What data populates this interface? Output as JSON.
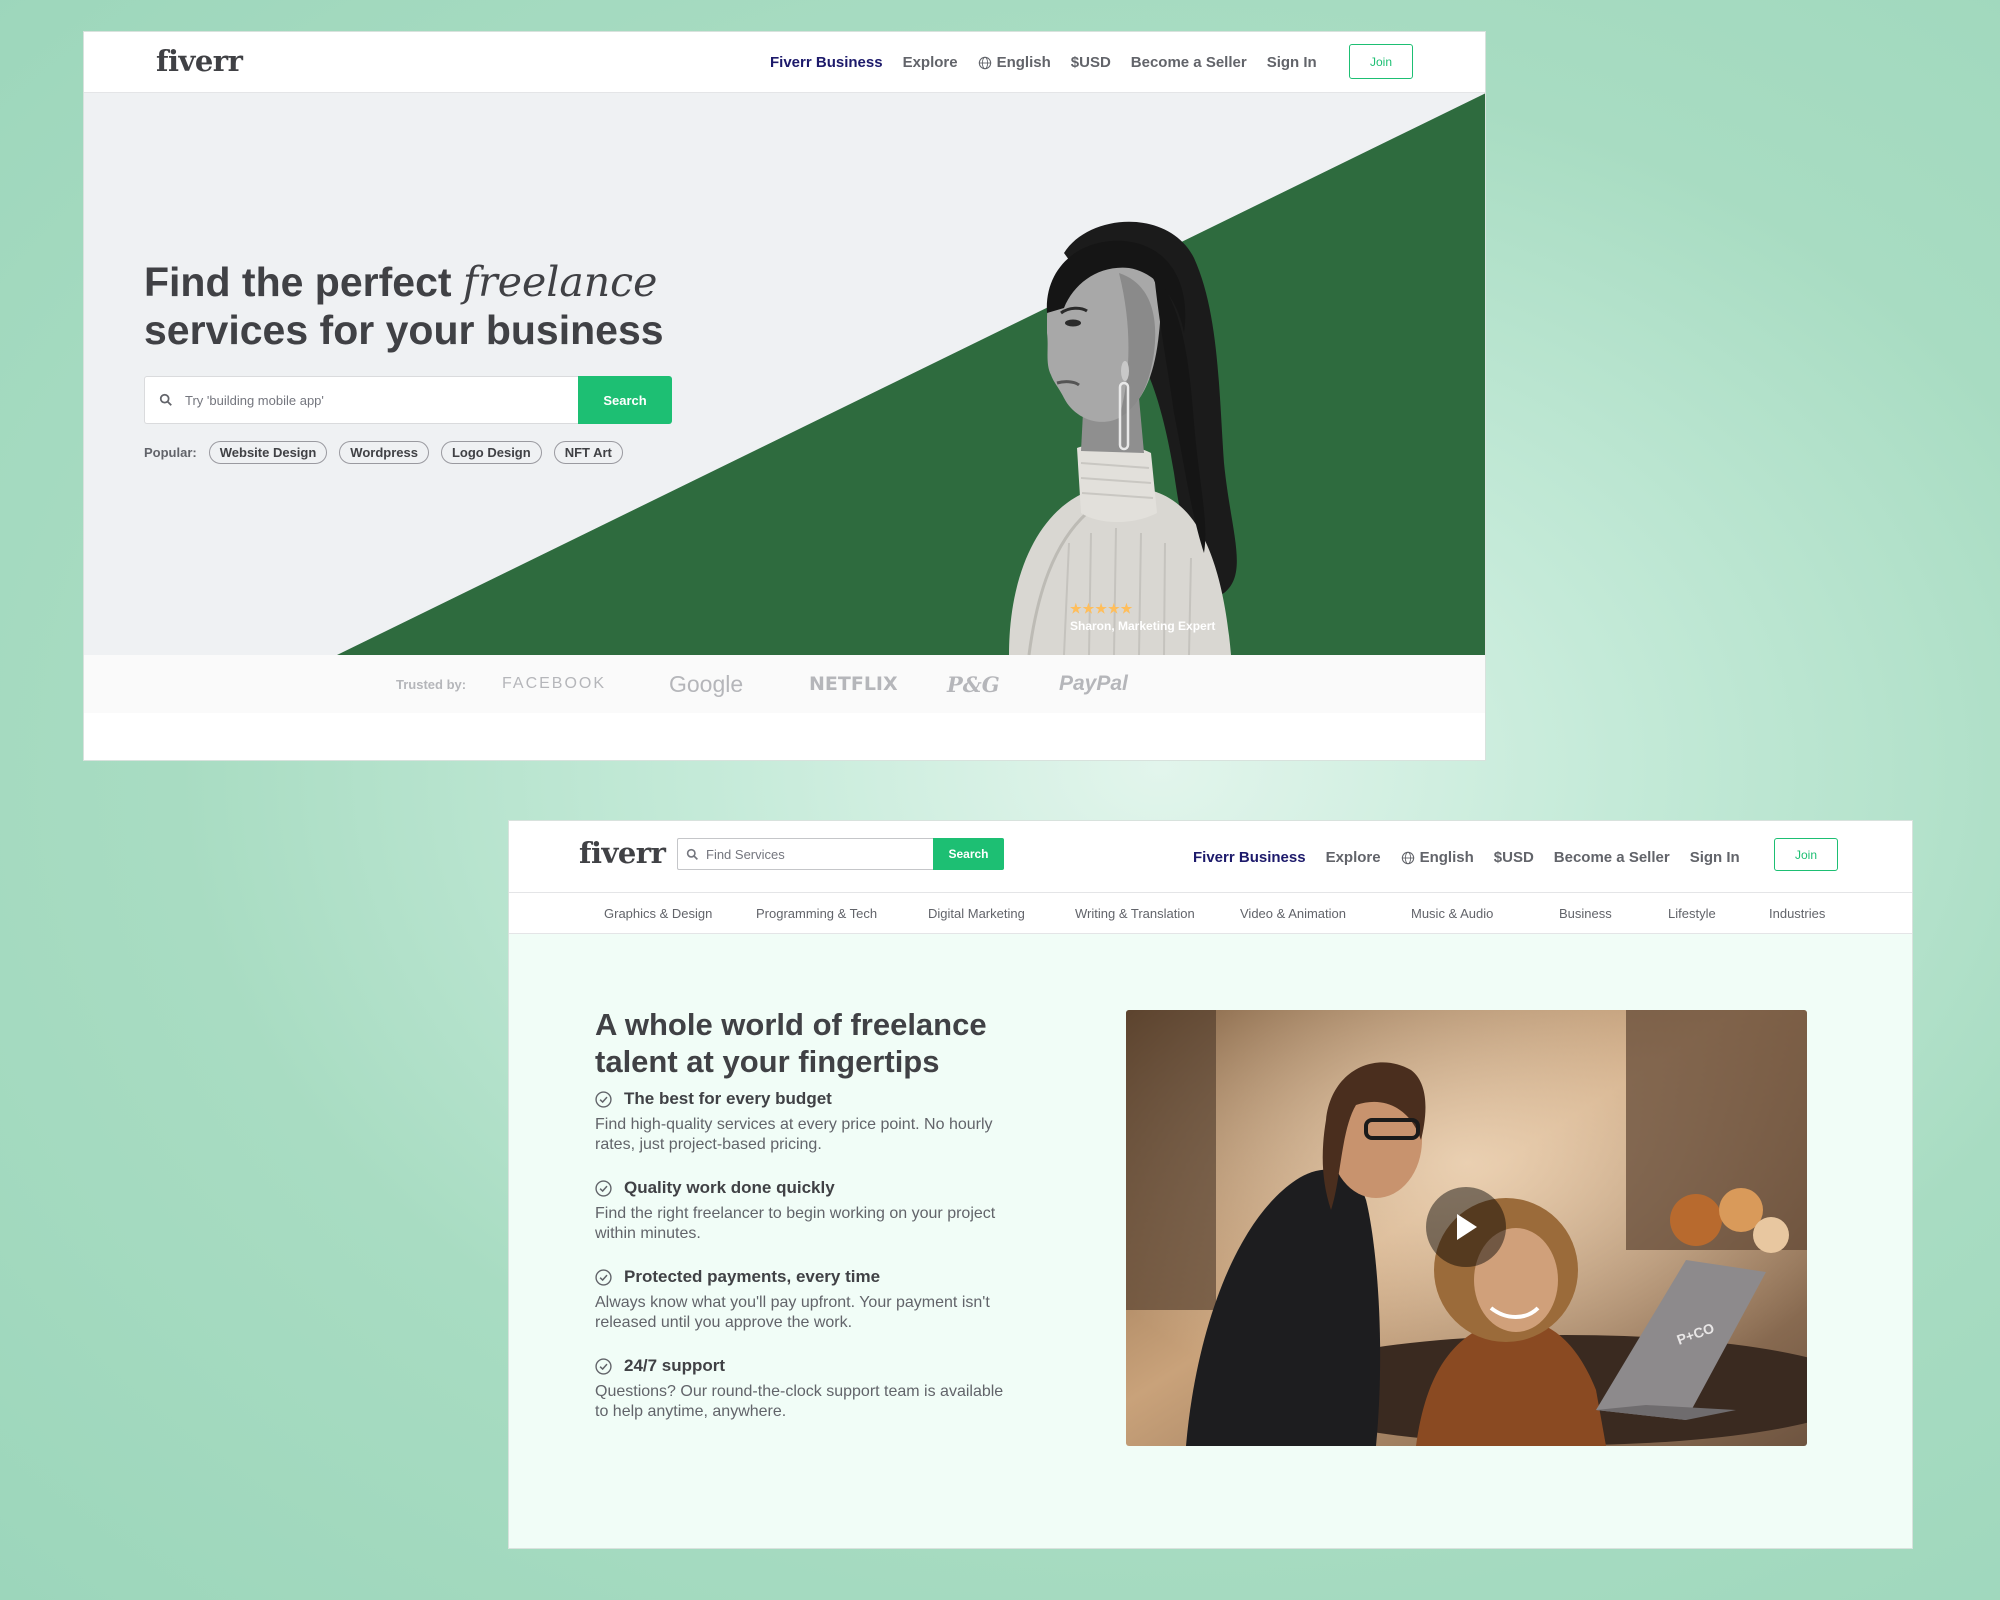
{
  "shot1": {
    "logo": "fiverr",
    "nav": {
      "fiverr_business": "Fiverr Business",
      "explore": "Explore",
      "language": "English",
      "currency": "$USD",
      "become_seller": "Become a Seller",
      "sign_in": "Sign In",
      "join": "Join"
    },
    "hero": {
      "headline_part1": "Find the perfect ",
      "headline_italic": "freelance",
      "headline_part2": "services for your business",
      "search_placeholder": "Try 'building mobile app'",
      "search_button": "Search",
      "popular_label": "Popular:",
      "popular_tags": [
        "Website Design",
        "Wordpress",
        "Logo Design",
        "NFT Art"
      ],
      "rating_stars": "★★★★★",
      "seller_caption": "Sharon, Marketing Expert"
    },
    "trusted": {
      "label": "Trusted by:",
      "brands": [
        "FACEBOOK",
        "Google",
        "NETFLIX",
        "P&G",
        "PayPal"
      ]
    }
  },
  "shot2": {
    "logo": "fiverr",
    "search": {
      "placeholder": "Find Services",
      "button": "Search"
    },
    "nav": {
      "fiverr_business": "Fiverr Business",
      "explore": "Explore",
      "language": "English",
      "currency": "$USD",
      "become_seller": "Become a Seller",
      "sign_in": "Sign In",
      "join": "Join"
    },
    "categories": [
      "Graphics & Design",
      "Programming & Tech",
      "Digital Marketing",
      "Writing & Translation",
      "Video & Animation",
      "Music & Audio",
      "Business",
      "Lifestyle",
      "Industries"
    ],
    "hero": {
      "headline": "A whole world of freelance talent at your fingertips",
      "features": [
        {
          "title": "The best for every budget",
          "desc": "Find high-quality services at every price point. No hourly rates, just project-based pricing."
        },
        {
          "title": "Quality work done quickly",
          "desc": "Find the right freelancer to begin working on your project within minutes."
        },
        {
          "title": "Protected payments, every time",
          "desc": "Always know what you'll pay upfront. Your payment isn't released until you approve the work."
        },
        {
          "title": "24/7 support",
          "desc": "Questions? Our round-the-clock support team is available to help anytime, anywhere."
        }
      ],
      "video_laptop_text": "P+CO"
    }
  },
  "colors": {
    "brand_green": "#1dbf73",
    "hero_dark_green": "#2e6b3e",
    "business_navy": "#1d1a6b",
    "text_dark": "#404145"
  }
}
